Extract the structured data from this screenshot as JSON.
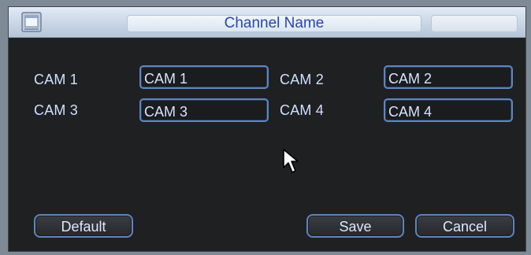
{
  "window": {
    "title": "Channel Name",
    "icon": "window-icon"
  },
  "channels": [
    {
      "label": "CAM 1",
      "value": "CAM 1"
    },
    {
      "label": "CAM 2",
      "value": "CAM 2"
    },
    {
      "label": "CAM 3",
      "value": "CAM 3"
    },
    {
      "label": "CAM 4",
      "value": "CAM 4"
    }
  ],
  "buttons": {
    "default": "Default",
    "save": "Save",
    "cancel": "Cancel"
  },
  "colors": {
    "accent": "#5e86c1",
    "title_text": "#2846b2",
    "panel_bg": "#1f2022",
    "label_text": "#cfe0ff"
  }
}
